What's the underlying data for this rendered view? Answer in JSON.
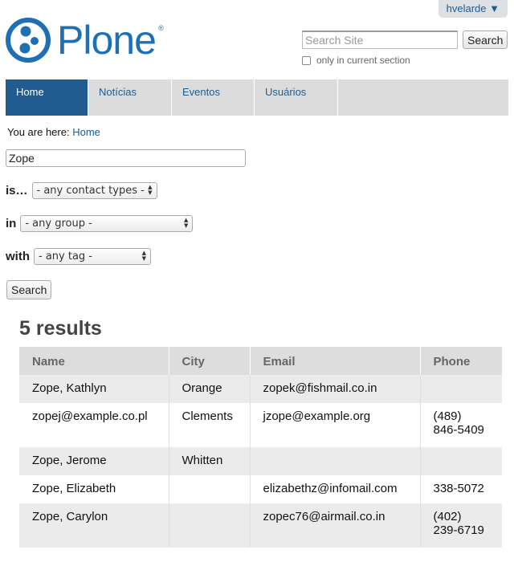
{
  "user_menu": {
    "label": "hvelarde ▼"
  },
  "logo": {
    "text": "Plone",
    "reg": "®"
  },
  "site_search": {
    "placeholder": "Search Site",
    "button": "Search",
    "current_section_label": "only in current section"
  },
  "nav": {
    "items": [
      {
        "label": "Home",
        "active": true
      },
      {
        "label": "Notícias"
      },
      {
        "label": "Eventos"
      },
      {
        "label": "Usuários"
      }
    ]
  },
  "breadcrumb": {
    "prefix": "You are here:",
    "home": "Home"
  },
  "filter": {
    "query_value": "Zope",
    "type_label": "is…",
    "type_value": "- any contact types -",
    "group_label": "in",
    "group_value": "- any group -",
    "tag_label": "with",
    "tag_value": "- any tag -",
    "search_button": "Search"
  },
  "results": {
    "title": "5 results",
    "columns": [
      "Name",
      "City",
      "Email",
      "Phone"
    ],
    "rows": [
      {
        "name": "Zope, Kathlyn",
        "city": "Orange",
        "email": "zopek@fishmail.co.in",
        "phone_1": "",
        "phone_2": ""
      },
      {
        "name": "zopej@example.co.pl",
        "city": "Clements",
        "email": "jzope@example.org",
        "phone_1": "(489)",
        "phone_2": "846-5409"
      },
      {
        "name": "Zope, Jerome",
        "city": "Whitten",
        "email": "",
        "phone_1": "",
        "phone_2": ""
      },
      {
        "name": "Zope, Elizabeth",
        "city": "",
        "email": "elizabethz@infomail.com",
        "phone_1": "338-5072",
        "phone_2": ""
      },
      {
        "name": "Zope, Carylon",
        "city": "",
        "email": "zopec76@airmail.co.in",
        "phone_1": "(402)",
        "phone_2": "239-6719"
      }
    ]
  },
  "colors": {
    "brand": "#1f6fb5",
    "nav_active": "#205c90",
    "nav_bg": "#dcdcdc"
  }
}
